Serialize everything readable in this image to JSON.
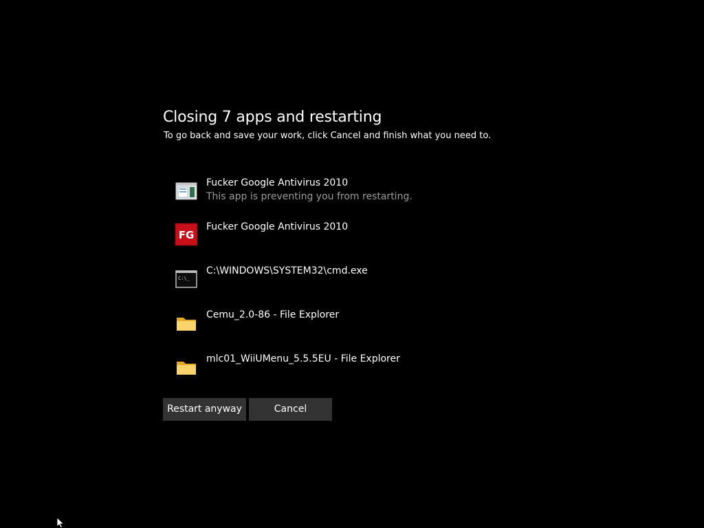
{
  "dialog": {
    "title": "Closing 7 apps and restarting",
    "subtitle": "To go back and save your work, click Cancel and finish what you need to."
  },
  "apps": [
    {
      "name": "Fucker Google Antivirus 2010",
      "status": "This app is preventing you from restarting.",
      "icon": "app-window-icon"
    },
    {
      "name": "Fucker Google Antivirus 2010",
      "status": "",
      "icon": "fg-logo-icon",
      "icon_text": "FG"
    },
    {
      "name": "C:\\WINDOWS\\SYSTEM32\\cmd.exe",
      "status": "",
      "icon": "command-prompt-icon",
      "icon_text": "C:\\_"
    },
    {
      "name": "Cemu_2.0-86 - File Explorer",
      "status": "",
      "icon": "folder-icon"
    },
    {
      "name": "mlc01_WiiUMenu_5.5.5EU - File Explorer",
      "status": "",
      "icon": "folder-icon"
    }
  ],
  "buttons": {
    "restart_label": "Restart anyway",
    "cancel_label": "Cancel"
  },
  "colors": {
    "background": "#000000",
    "text": "#ffffff",
    "status_text": "#9a9a9a",
    "button": "#333333",
    "fg_icon_red": "#c8101a",
    "folder_yellow": "#f4c84a"
  }
}
